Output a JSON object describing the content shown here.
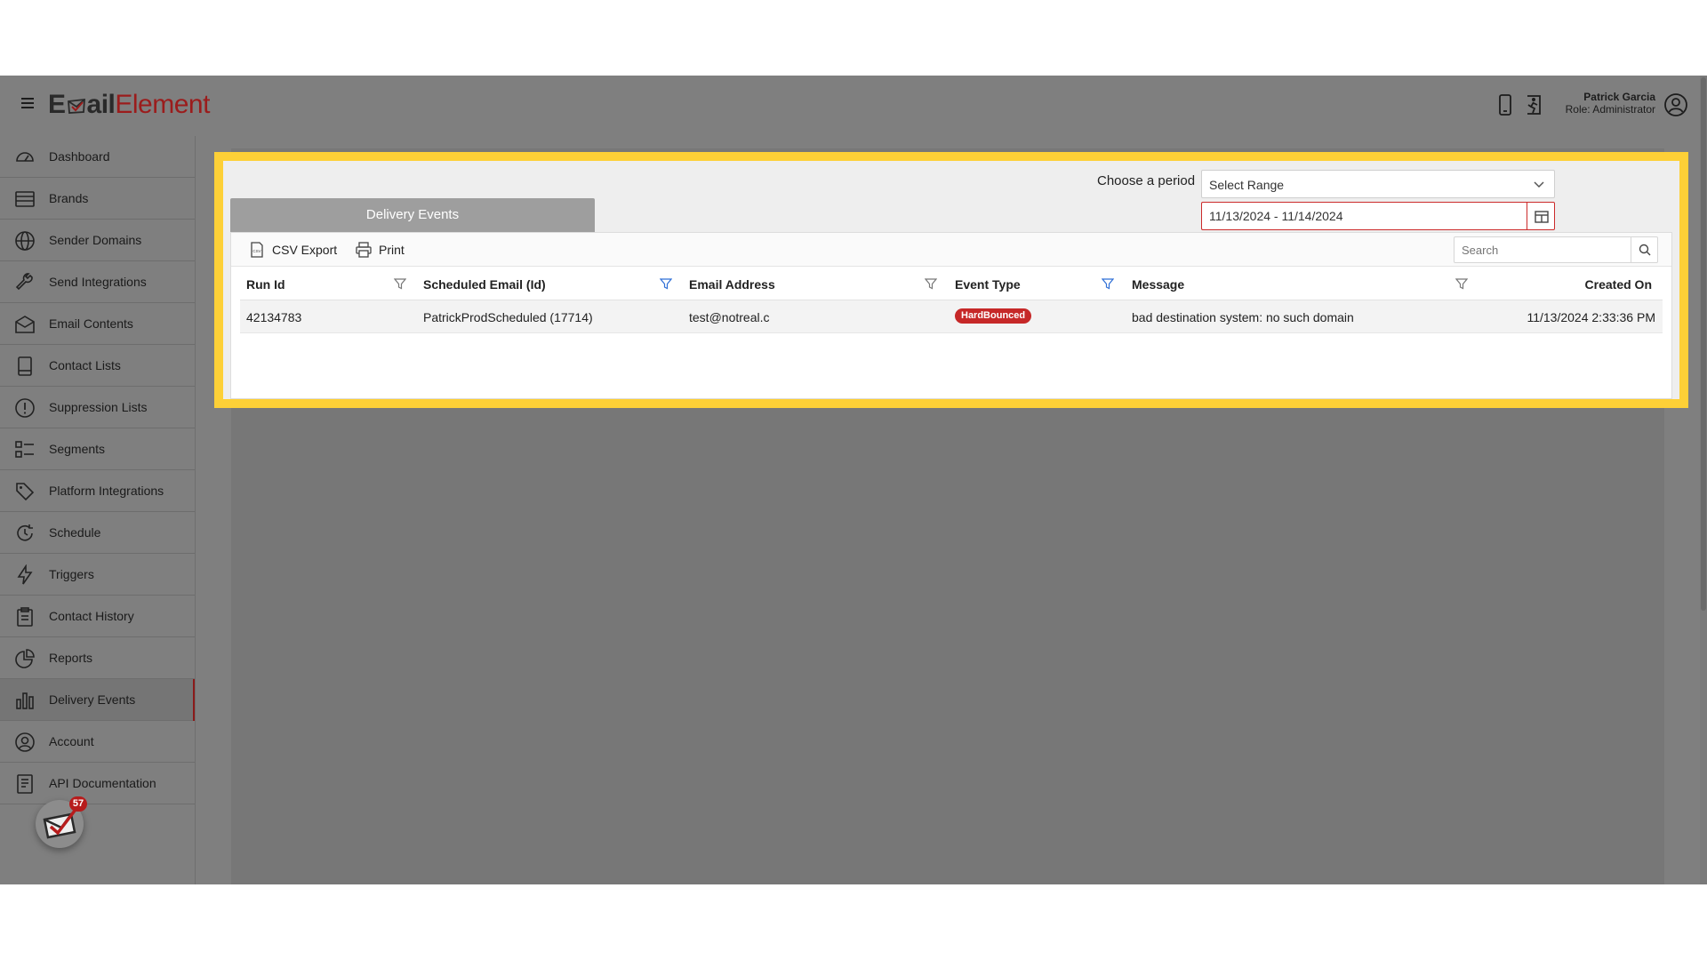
{
  "header": {
    "logo_part1": "E",
    "logo_part2": "ail",
    "logo_part3": "Element",
    "user_name": "Patrick Garcia",
    "user_role": "Role: Administrator",
    "icons": [
      "menu-icon",
      "mobile-device-icon",
      "exit-running-icon",
      "user-circle-icon"
    ]
  },
  "sidebar": {
    "items": [
      {
        "label": "Dashboard",
        "icon": "dashboard-gauge-icon"
      },
      {
        "label": "Brands",
        "icon": "brands-list-icon"
      },
      {
        "label": "Sender Domains",
        "icon": "globe-icon"
      },
      {
        "label": "Send Integrations",
        "icon": "wrench-icon"
      },
      {
        "label": "Email Contents",
        "icon": "envelope-icon"
      },
      {
        "label": "Contact Lists",
        "icon": "contact-book-icon"
      },
      {
        "label": "Suppression Lists",
        "icon": "exclamation-circle-icon"
      },
      {
        "label": "Segments",
        "icon": "segments-list-icon"
      },
      {
        "label": "Platform Integrations",
        "icon": "tag-icon"
      },
      {
        "label": "Schedule",
        "icon": "clock-refresh-icon"
      },
      {
        "label": "Triggers",
        "icon": "lightning-icon"
      },
      {
        "label": "Contact History",
        "icon": "clipboard-icon"
      },
      {
        "label": "Reports",
        "icon": "pie-chart-icon"
      },
      {
        "label": "Delivery Events",
        "icon": "bar-chart-icon"
      },
      {
        "label": "Account",
        "icon": "user-circle-icon"
      },
      {
        "label": "API Documentation",
        "icon": "document-icon"
      }
    ],
    "active": "Delivery Events",
    "notification_count": "57",
    "notification_icon": "mail-check-icon"
  },
  "filters": {
    "period_label": "Choose a period",
    "range_select_value": "Select Range",
    "date_range_value": "11/13/2024 - 11/14/2024"
  },
  "tab": {
    "label": "Delivery Events"
  },
  "toolbar": {
    "csv_label": "CSV Export",
    "print_label": "Print",
    "search_placeholder": "Search"
  },
  "table": {
    "columns": [
      "Run Id",
      "Scheduled Email (Id)",
      "Email Address",
      "Event Type",
      "Message",
      "Created On"
    ],
    "rows": [
      {
        "run_id": "42134783",
        "scheduled_email": "PatrickProdScheduled (17714)",
        "email_address": "test@notreal.c",
        "event_type": "HardBounced",
        "message": "bad destination system: no such domain",
        "created_on": "11/13/2024 2:33:36 PM"
      }
    ]
  },
  "colors": {
    "accent": "#8b1a1a",
    "highlight_border": "#fdd037",
    "badge_red": "#c62828",
    "filter_active": "#2f6fd6"
  }
}
